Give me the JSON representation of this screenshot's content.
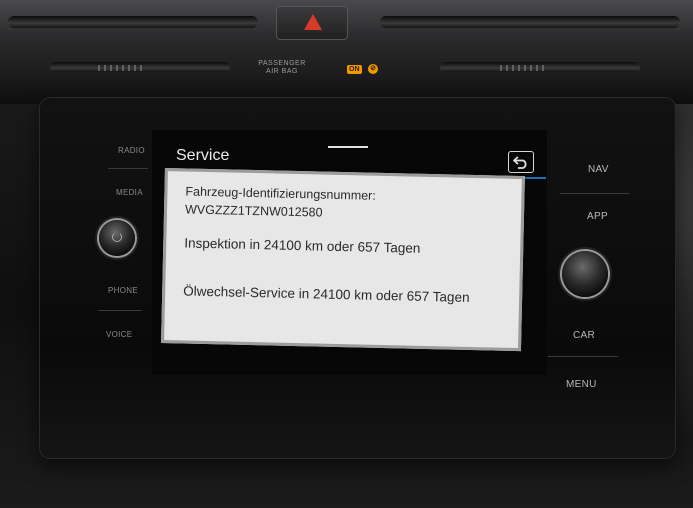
{
  "dashboard": {
    "airbag_label_line1": "PASSENGER",
    "airbag_label_line2": "AIR BAG",
    "airbag_status": "ON",
    "airbag_off_symbol": "⊘"
  },
  "left_buttons": [
    "RADIO",
    "MEDIA",
    "PHONE",
    "VOICE"
  ],
  "right_buttons": [
    "NAV",
    "APP",
    "CAR",
    "MENU"
  ],
  "screen": {
    "title": "Service"
  },
  "service_dialog": {
    "vin_label": "Fahrzeug-Identifizierungsnummer:",
    "vin_value": "WVGZZZ1TZNW012580",
    "inspection": "Inspektion in 24100 km oder 657 Tagen",
    "oil_service": "Ölwechsel-Service in 24100 km oder 657 Tagen"
  },
  "icons": {
    "hazard": "hazard-triangle-icon",
    "back": "back-arrow-icon",
    "power": "power-icon"
  },
  "colors": {
    "accent_line": "#1f6fbd",
    "hazard": "#d63a2a",
    "airbag_lamp": "#f09a00"
  }
}
